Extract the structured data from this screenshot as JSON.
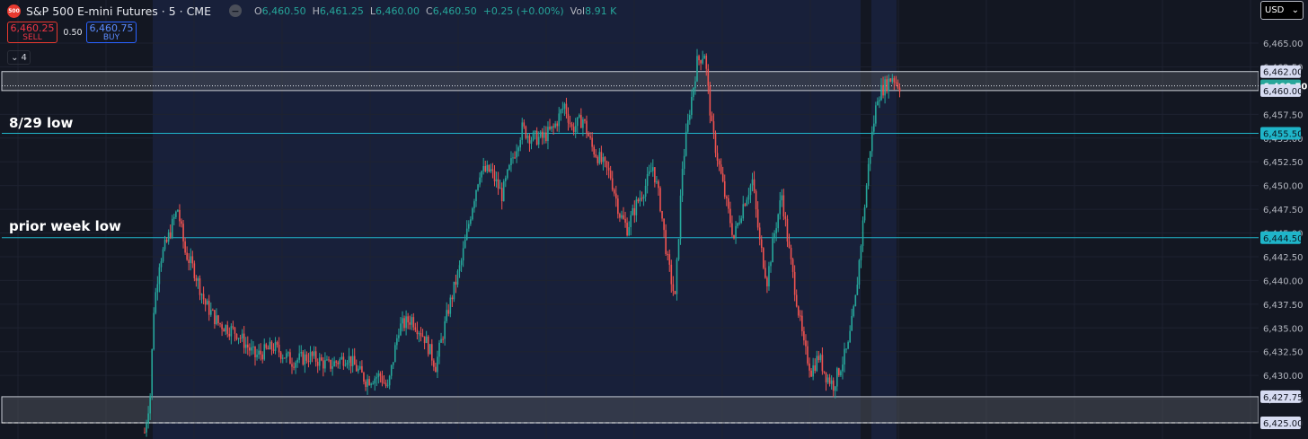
{
  "header": {
    "symbol_logo": "500",
    "title": "S&P 500 E-mini Futures · 5 · CME",
    "ohlc": [
      {
        "key": "O",
        "value": "6,460.50"
      },
      {
        "key": "H",
        "value": "6,461.25"
      },
      {
        "key": "L",
        "value": "6,460.00"
      },
      {
        "key": "C",
        "value": "6,460.50"
      },
      {
        "key": "",
        "value": "+0.25 (+0.00%)"
      },
      {
        "key": "Vol",
        "value": "8.91 K"
      }
    ]
  },
  "trade": {
    "sell_price": "6,460.25",
    "sell_label": "SELL",
    "spread": "0.50",
    "buy_price": "6,460.75",
    "buy_label": "BUY"
  },
  "indicator_toggle": {
    "count": "4",
    "icon": "chevron-down-icon"
  },
  "currency": {
    "label": "USD",
    "icon": "chevron-down-icon"
  },
  "colors": {
    "background": "#131722",
    "session_band": "#18203a",
    "up": "#26a69a",
    "down": "#ef5350",
    "level_line": "#1fb5c9",
    "zone_fill": "#4a4e58"
  },
  "chart_data": {
    "type": "candlestick",
    "title": "S&P 500 E-mini Futures · 5 · CME",
    "ylim": [
      6422.0,
      6467.5
    ],
    "y_ticks": [
      "6,465.00",
      "6,462.50",
      "6,460.00",
      "6,457.50",
      "6,455.00",
      "6,452.50",
      "6,450.00",
      "6,447.50",
      "6,445.00",
      "6,442.50",
      "6,440.00",
      "6,437.50",
      "6,435.00",
      "6,432.50",
      "6,430.00",
      "6,427.50",
      "6,425.00"
    ],
    "grid": true,
    "price_labels": [
      {
        "text": "6,462.00",
        "kind": "zone"
      },
      {
        "text": "6,460.50",
        "kind": "last"
      },
      {
        "text": "6,460.00",
        "kind": "zone"
      },
      {
        "text": "6,455.50",
        "kind": "level"
      },
      {
        "text": "6,444.50",
        "kind": "level"
      },
      {
        "text": "6,427.75",
        "kind": "zone"
      },
      {
        "text": "6,425.00",
        "kind": "zone"
      }
    ],
    "levels": [
      {
        "label": "8/29 low",
        "price": 6455.5
      },
      {
        "label": "prior week low",
        "price": 6444.5
      }
    ],
    "zones": [
      {
        "from": 6460.0,
        "to": 6462.0
      },
      {
        "from": 6425.0,
        "to": 6427.75
      }
    ],
    "last_price": 6460.5,
    "anchors": [
      [
        0,
        6424
      ],
      [
        3,
        6428
      ],
      [
        5,
        6437
      ],
      [
        8,
        6442
      ],
      [
        12,
        6444
      ],
      [
        16,
        6446.5
      ],
      [
        18,
        6447.5
      ],
      [
        22,
        6443
      ],
      [
        27,
        6441
      ],
      [
        33,
        6437.5
      ],
      [
        40,
        6435.5
      ],
      [
        50,
        6434.5
      ],
      [
        60,
        6432
      ],
      [
        70,
        6433
      ],
      [
        80,
        6431.5
      ],
      [
        90,
        6432
      ],
      [
        100,
        6431
      ],
      [
        110,
        6432
      ],
      [
        120,
        6429.5
      ],
      [
        128,
        6430
      ],
      [
        132,
        6428.5
      ],
      [
        138,
        6435
      ],
      [
        145,
        6436
      ],
      [
        152,
        6434
      ],
      [
        158,
        6431
      ],
      [
        165,
        6437
      ],
      [
        172,
        6442
      ],
      [
        178,
        6448
      ],
      [
        182,
        6451.5
      ],
      [
        188,
        6451.5
      ],
      [
        194,
        6449
      ],
      [
        200,
        6453
      ],
      [
        205,
        6456
      ],
      [
        210,
        6455
      ],
      [
        216,
        6455
      ],
      [
        222,
        6456
      ],
      [
        228,
        6458.5
      ],
      [
        232,
        6456
      ],
      [
        238,
        6457
      ],
      [
        243,
        6454
      ],
      [
        248,
        6452.5
      ],
      [
        253,
        6451
      ],
      [
        258,
        6447
      ],
      [
        262,
        6445.5
      ],
      [
        267,
        6448
      ],
      [
        272,
        6450
      ],
      [
        276,
        6452
      ],
      [
        280,
        6448
      ],
      [
        284,
        6442
      ],
      [
        288,
        6438
      ],
      [
        292,
        6452
      ],
      [
        296,
        6458
      ],
      [
        300,
        6463
      ],
      [
        304,
        6464
      ],
      [
        308,
        6456
      ],
      [
        312,
        6452
      ],
      [
        316,
        6448
      ],
      [
        320,
        6444.5
      ],
      [
        325,
        6448
      ],
      [
        330,
        6450.5
      ],
      [
        334,
        6444
      ],
      [
        338,
        6440
      ],
      [
        342,
        6445
      ],
      [
        346,
        6449
      ],
      [
        350,
        6443
      ],
      [
        354,
        6438
      ],
      [
        358,
        6433
      ],
      [
        362,
        6430.5
      ],
      [
        366,
        6432
      ],
      [
        370,
        6430
      ],
      [
        374,
        6429
      ],
      [
        378,
        6431
      ],
      [
        382,
        6433
      ],
      [
        386,
        6438
      ],
      [
        390,
        6446
      ],
      [
        394,
        6454
      ],
      [
        398,
        6459.5
      ],
      [
        402,
        6460.5
      ],
      [
        406,
        6461.5
      ],
      [
        410,
        6460.5
      ]
    ]
  }
}
